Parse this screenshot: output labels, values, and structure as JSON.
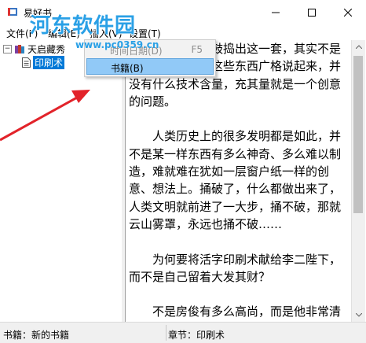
{
  "window": {
    "title": "易好书",
    "minimize_icon": "minimize-icon",
    "maximize_icon": "maximize-icon",
    "close_icon": "close-icon"
  },
  "watermark": {
    "text": "河东软件园",
    "url": "www.pc0359.cn",
    "color": "#2aa0e6"
  },
  "menubar": {
    "items": [
      {
        "label": "文件(F)"
      },
      {
        "label": "编辑(E)"
      },
      {
        "label": "插入(V)"
      },
      {
        "label": "设置(T)"
      }
    ]
  },
  "insert_menu": {
    "items": [
      {
        "label": "时间日期(D)",
        "shortcut": "F5",
        "enabled": false
      },
      {
        "label": "书籍(B)",
        "shortcut": "",
        "enabled": true,
        "highlighted": true
      }
    ]
  },
  "tree": {
    "root": {
      "label": "天启藏秀",
      "expanded": true
    },
    "child": {
      "label": "印刷术",
      "selected": true
    }
  },
  "content": {
    "text": "用了几个月时间鼓捣出这一套，其实不是什么难事。因为这些东西广格说起来，并没有什么技术含量，充其量就是一个创意的问题。\n\n　　人类历史上的很多发明都是如此，并不是某一样东西有多么神奇、多么难以制造，难就难在犹如一层窗户纸一样的创意、想法上。捅破了，什么都做出来了，人类文明就前进了一大步，捅不破，那就云山雾罩，永远也捅不破……\n\n　　为何要将活字印刷术献给李二陛下，而不是自己留着大发其财？\n\n　　不是房俊有多么高尚，而是他非常清楚，自己玩不转这个东西……"
  },
  "statusbar": {
    "book": "书籍：新的书籍",
    "chapter": "章节：印刷术"
  },
  "colors": {
    "accent": "#0078d7",
    "annotation_arrow": "#e2232a",
    "menu_highlight": "#91c9f7"
  }
}
